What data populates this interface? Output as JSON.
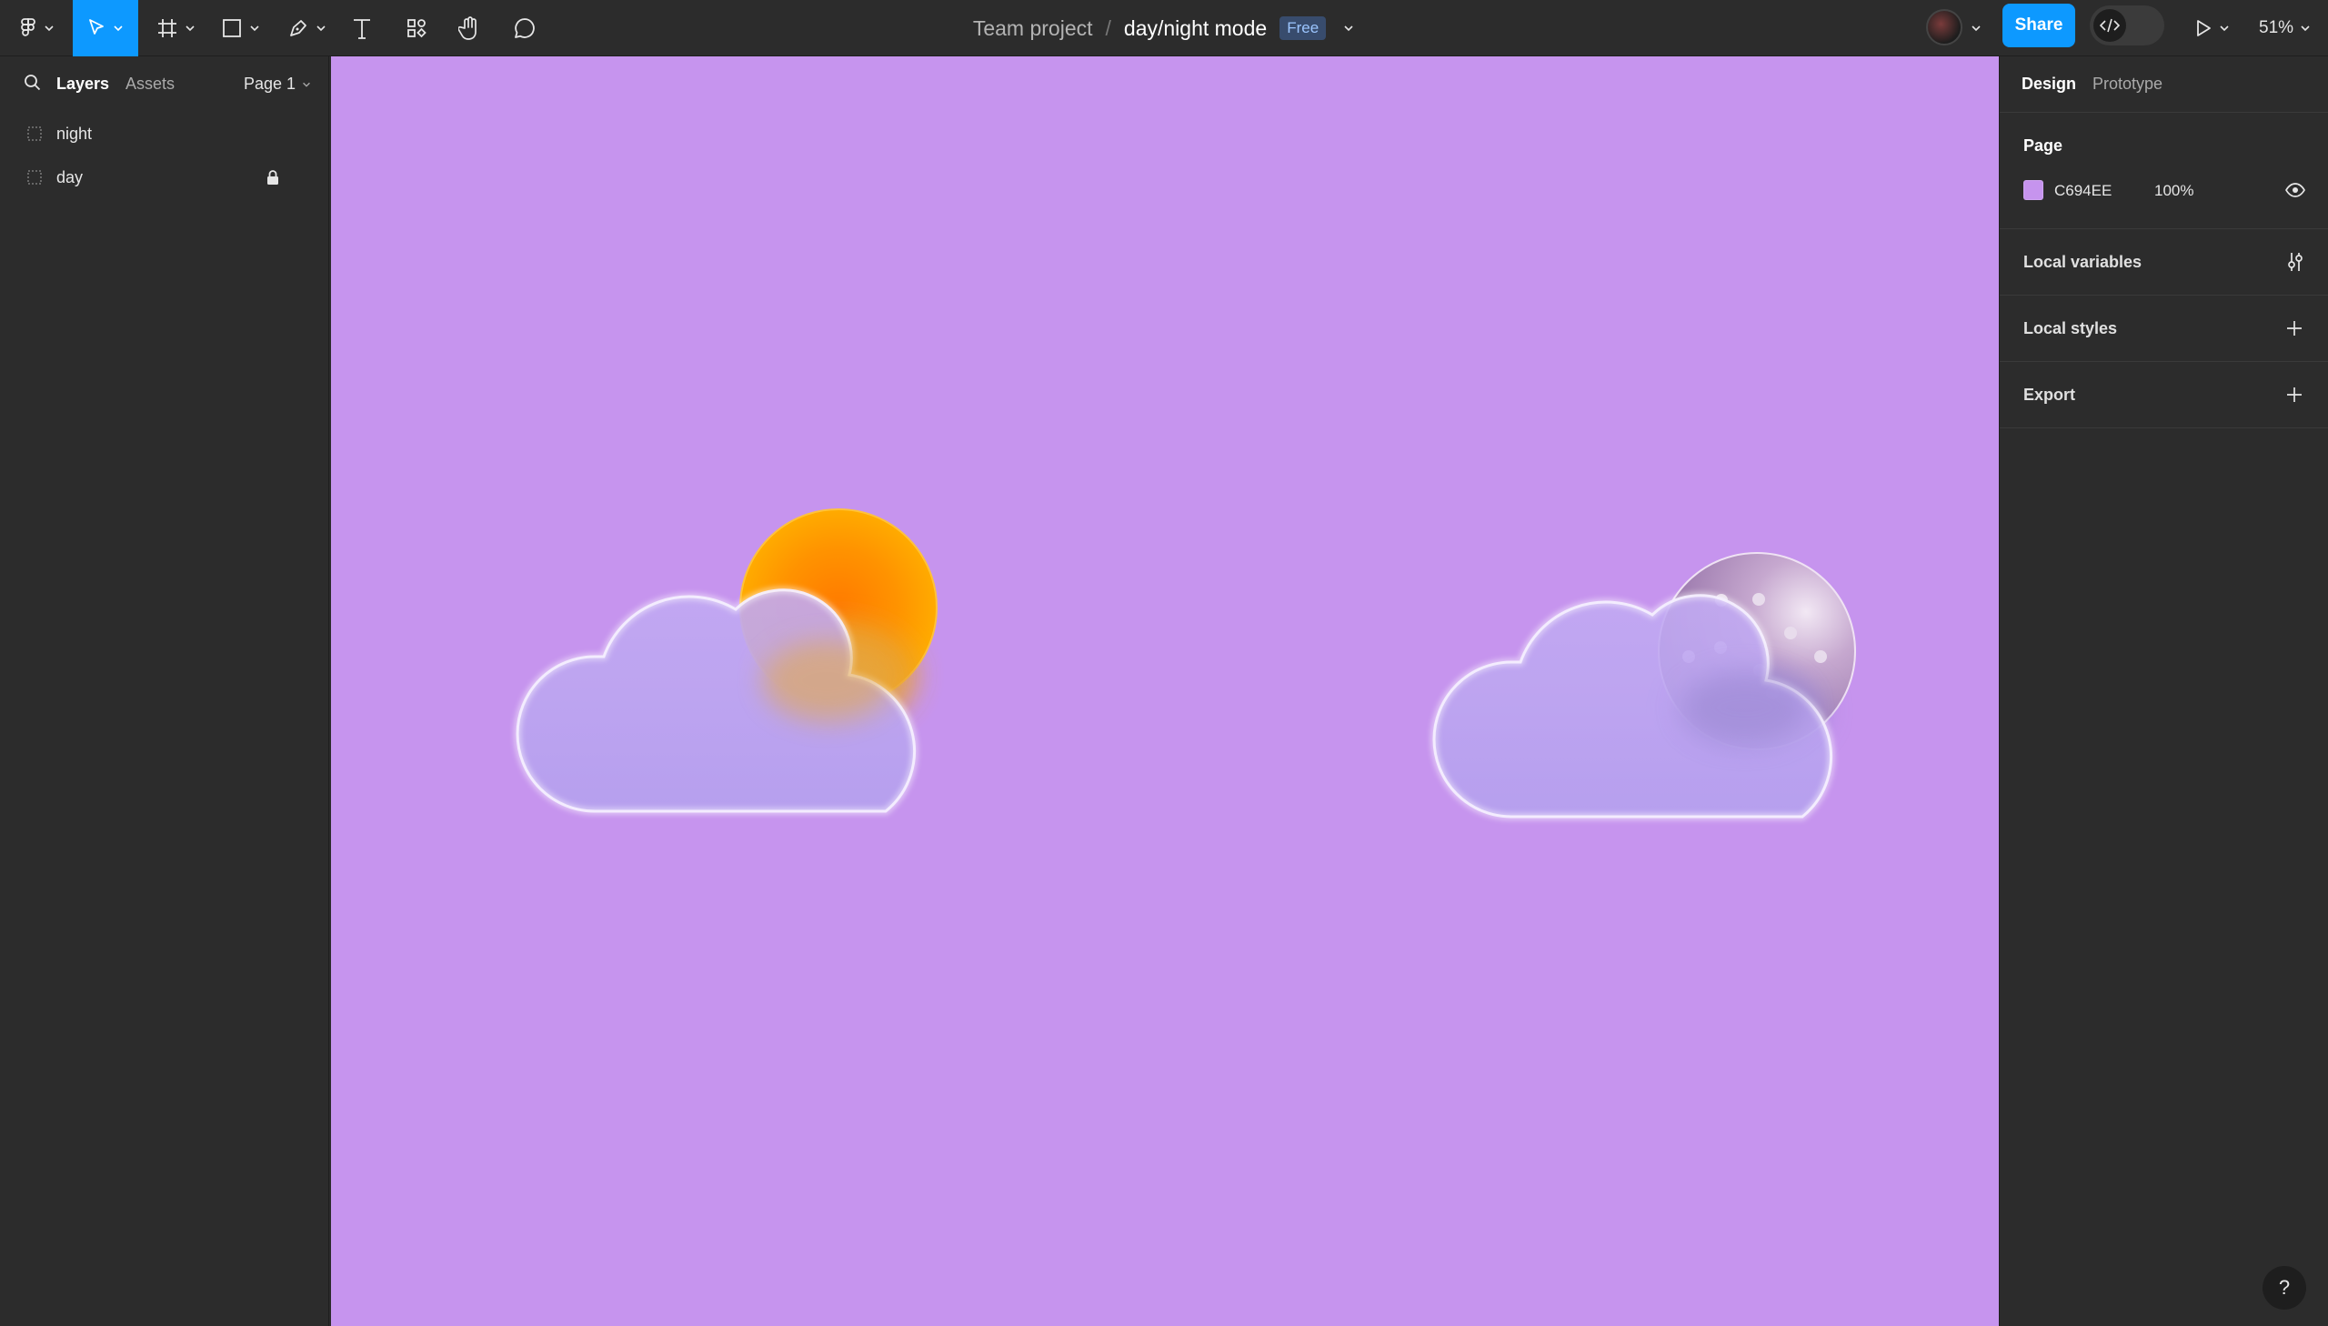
{
  "toolbar": {
    "tools": [
      "menu",
      "move",
      "frame",
      "shape",
      "pen",
      "text",
      "resources",
      "hand",
      "comment"
    ]
  },
  "file": {
    "project": "Team project",
    "separator": "/",
    "name": "day/night mode",
    "badge": "Free"
  },
  "header_right": {
    "share_label": "Share",
    "zoom": "51%"
  },
  "left_panel": {
    "tabs": [
      "Layers",
      "Assets"
    ],
    "page_selector": "Page 1",
    "layers": [
      {
        "name": "night",
        "locked": false
      },
      {
        "name": "day",
        "locked": true
      }
    ]
  },
  "right_panel": {
    "tabs": [
      "Design",
      "Prototype"
    ],
    "page_section_title": "Page",
    "page_color_hex": "C694EE",
    "page_color": "#c694ee",
    "page_opacity": "100%",
    "sections": [
      "Local variables",
      "Local styles",
      "Export"
    ]
  },
  "canvas": {
    "background": "#c694ee",
    "icons": [
      "day-cloud-with-sun",
      "night-cloud-with-moon"
    ]
  },
  "help_label": "?",
  "colors": {
    "accent": "#0d99ff",
    "panel": "#2c2c2c"
  }
}
